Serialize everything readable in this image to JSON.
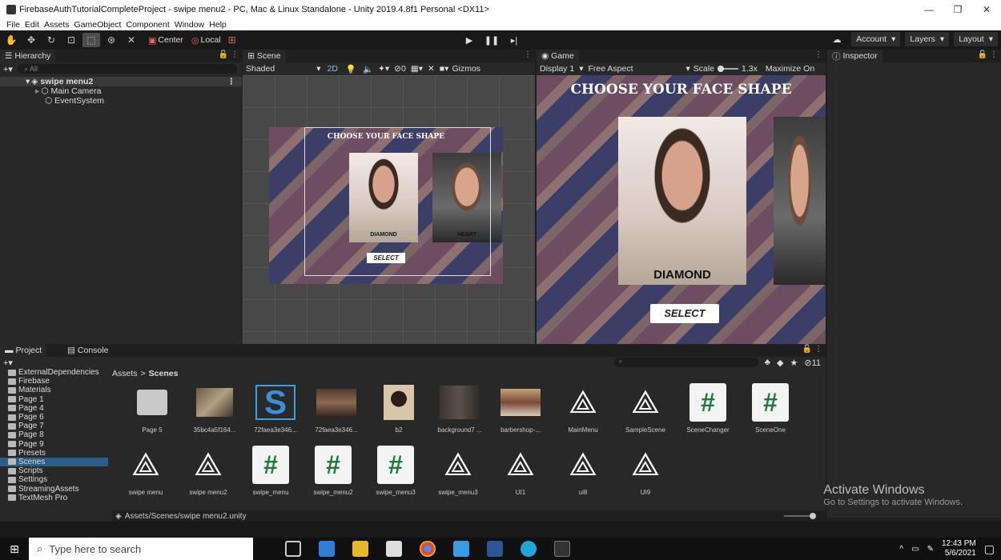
{
  "window": {
    "title": "FirebaseAuthTutorialCompleteProject - swipe menu2 - PC, Mac & Linux Standalone - Unity 2019.4.8f1 Personal <DX11>",
    "minimize": "—",
    "maximize": "❐",
    "close": "✕"
  },
  "menu": [
    "File",
    "Edit",
    "Assets",
    "GameObject",
    "Component",
    "Window",
    "Help"
  ],
  "toolbar": {
    "pivot_center": "Center",
    "pivot_local": "Local",
    "account": "Account",
    "layers": "Layers",
    "layout": "Layout"
  },
  "hierarchy": {
    "tab": "Hierarchy",
    "search_placeholder": "All",
    "scene_name": "swipe menu2",
    "items": [
      "Main Camera",
      "EventSystem"
    ]
  },
  "scene": {
    "tab": "Scene",
    "shading": "Shaded",
    "mode_2d": "2D",
    "gizmos": "Gizmos",
    "hidden_count": "0",
    "preview": {
      "title": "CHOOSE YOUR FACE SHAPE",
      "card1_label": "DIAMOND",
      "card2_label": "HEART",
      "button": "SELECT"
    }
  },
  "game": {
    "tab": "Game",
    "display": "Display 1",
    "aspect": "Free Aspect",
    "scale_label": "Scale",
    "scale_value": "1.3x",
    "maximize": "Maximize On",
    "preview": {
      "title": "CHOOSE YOUR FACE SHAPE",
      "card_label": "DIAMOND",
      "button": "SELECT"
    }
  },
  "inspector": {
    "tab": "Inspector"
  },
  "project": {
    "tab_project": "Project",
    "tab_console": "Console",
    "hidden_count": "11",
    "breadcrumb": [
      "Assets",
      "Scenes"
    ],
    "tree": [
      "ExternalDependencies",
      "Firebase",
      "Materials",
      "Page 1",
      "Page 4",
      "Page 6",
      "Page 7",
      "Page 8",
      "Page 9",
      "Presets",
      "Scenes",
      "Scripts",
      "Settings",
      "StreamingAssets",
      "TextMesh Pro"
    ],
    "assets_row1": [
      {
        "name": "Page 5",
        "kind": "folder"
      },
      {
        "name": "35bc4a5f164...",
        "kind": "image"
      },
      {
        "name": "72faea3e346...",
        "kind": "sprite-s"
      },
      {
        "name": "72faea3e346...",
        "kind": "image"
      },
      {
        "name": "b2",
        "kind": "image"
      },
      {
        "name": "background7 ...",
        "kind": "image"
      },
      {
        "name": "barbershop-...",
        "kind": "image"
      },
      {
        "name": "MainMenu",
        "kind": "unity"
      },
      {
        "name": "SampleScene",
        "kind": "unity"
      },
      {
        "name": "SceneChanger",
        "kind": "script"
      },
      {
        "name": "SceneOne",
        "kind": "script"
      }
    ],
    "assets_row2": [
      {
        "name": "swipe menu",
        "kind": "unity"
      },
      {
        "name": "swipe menu2",
        "kind": "unity"
      },
      {
        "name": "swipe_menu",
        "kind": "script"
      },
      {
        "name": "swipe_menu2",
        "kind": "script"
      },
      {
        "name": "swipe_menu3",
        "kind": "script"
      },
      {
        "name": "swipe_menu3",
        "kind": "unity"
      },
      {
        "name": "UI1",
        "kind": "unity"
      },
      {
        "name": "ui8",
        "kind": "unity"
      },
      {
        "name": "UI9",
        "kind": "unity"
      }
    ],
    "selected_path": "Assets/Scenes/swipe menu2.unity"
  },
  "watermark": {
    "line1": "Activate Windows",
    "line2": "Go to Settings to activate Windows."
  },
  "taskbar": {
    "search_placeholder": "Type here to search",
    "time": "12:43 PM",
    "date": "5/6/2021"
  }
}
